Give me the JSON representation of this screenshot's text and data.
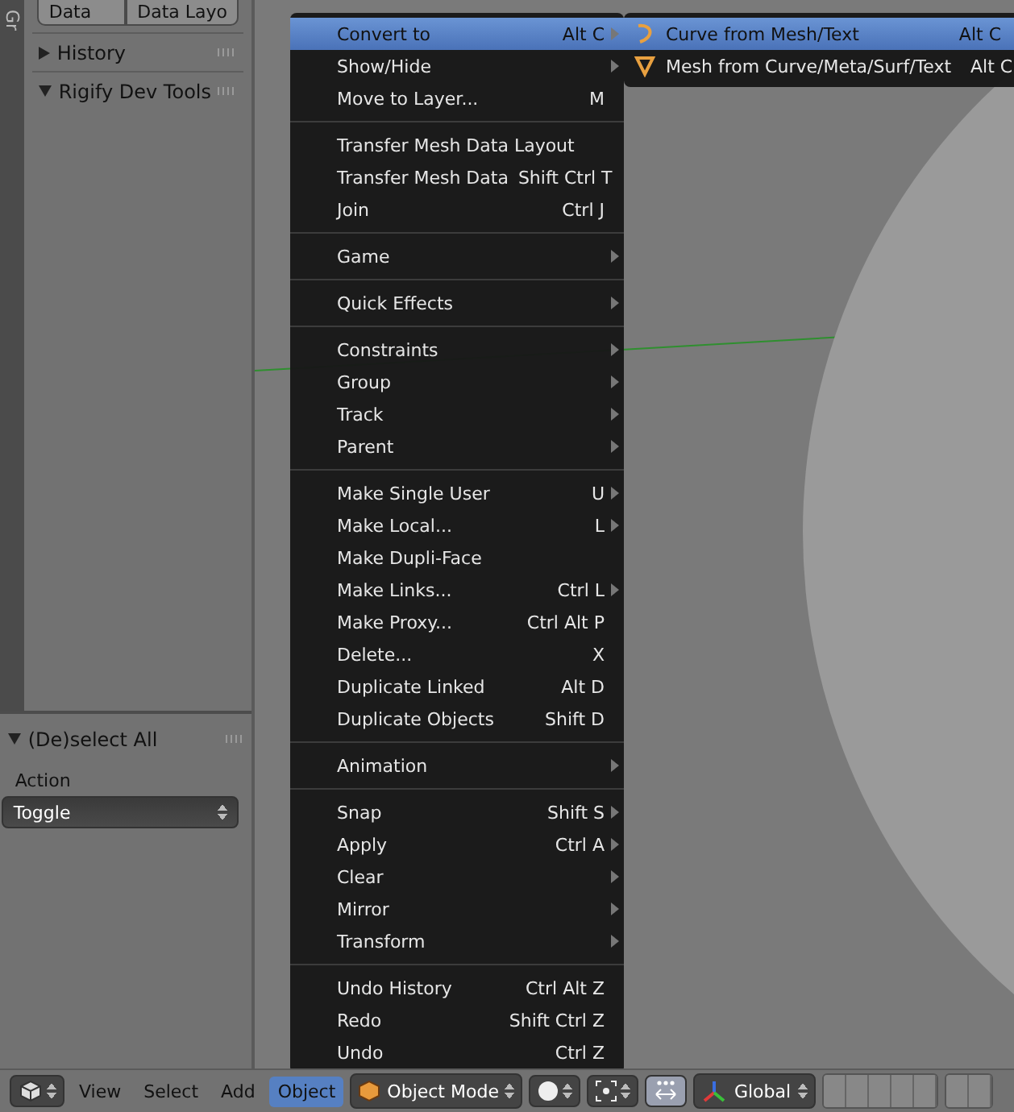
{
  "sidebar": {
    "vertical_tab": "Gr",
    "tabs": [
      {
        "label": "Data",
        "selected": false
      },
      {
        "label": "Data Layo",
        "selected": false
      }
    ],
    "panels": [
      {
        "title": "History",
        "expanded": false
      },
      {
        "title": "Rigify Dev Tools",
        "expanded": true
      }
    ],
    "operator_panel": {
      "title": "(De)select All",
      "expanded": true,
      "field_label": "Action",
      "field_value": "Toggle"
    }
  },
  "menu": {
    "sections": [
      [
        {
          "label": "Convert to",
          "shortcut": "Alt C",
          "submenu": true,
          "selected": true
        },
        {
          "label": "Show/Hide",
          "submenu": true,
          "selected": false
        },
        {
          "label": "Move to Layer...",
          "shortcut": "M",
          "submenu": false,
          "selected": false
        }
      ],
      [
        {
          "label": "Transfer Mesh Data Layout",
          "submenu": false,
          "selected": false
        },
        {
          "label": "Transfer Mesh Data",
          "shortcut": "Shift Ctrl T",
          "submenu": false,
          "selected": false
        },
        {
          "label": "Join",
          "shortcut": "Ctrl J",
          "submenu": false,
          "selected": false
        }
      ],
      [
        {
          "label": "Game",
          "submenu": true,
          "selected": false
        }
      ],
      [
        {
          "label": "Quick Effects",
          "submenu": true,
          "selected": false
        }
      ],
      [
        {
          "label": "Constraints",
          "submenu": true,
          "selected": false
        },
        {
          "label": "Group",
          "submenu": true,
          "selected": false
        },
        {
          "label": "Track",
          "submenu": true,
          "selected": false
        },
        {
          "label": "Parent",
          "submenu": true,
          "selected": false
        }
      ],
      [
        {
          "label": "Make Single User",
          "shortcut": "U",
          "submenu": true,
          "selected": false
        },
        {
          "label": "Make Local...",
          "shortcut": "L",
          "submenu": true,
          "selected": false
        },
        {
          "label": "Make Dupli-Face",
          "submenu": false,
          "selected": false
        },
        {
          "label": "Make Links...",
          "shortcut": "Ctrl L",
          "submenu": true,
          "selected": false
        },
        {
          "label": "Make Proxy...",
          "shortcut": "Ctrl Alt P",
          "submenu": false,
          "selected": false
        },
        {
          "label": "Delete...",
          "shortcut": "X",
          "submenu": false,
          "selected": false
        },
        {
          "label": "Duplicate Linked",
          "shortcut": "Alt D",
          "submenu": false,
          "selected": false
        },
        {
          "label": "Duplicate Objects",
          "shortcut": "Shift D",
          "submenu": false,
          "selected": false
        }
      ],
      [
        {
          "label": "Animation",
          "submenu": true,
          "selected": false
        }
      ],
      [
        {
          "label": "Snap",
          "shortcut": "Shift S",
          "submenu": true,
          "selected": false
        },
        {
          "label": "Apply",
          "shortcut": "Ctrl A",
          "submenu": true,
          "selected": false
        },
        {
          "label": "Clear",
          "submenu": true,
          "selected": false
        },
        {
          "label": "Mirror",
          "submenu": true,
          "selected": false
        },
        {
          "label": "Transform",
          "submenu": true,
          "selected": false
        }
      ],
      [
        {
          "label": "Undo History",
          "shortcut": "Ctrl Alt Z",
          "submenu": false,
          "selected": false
        },
        {
          "label": "Redo",
          "shortcut": "Shift Ctrl Z",
          "submenu": false,
          "selected": false
        },
        {
          "label": "Undo",
          "shortcut": "Ctrl Z",
          "submenu": false,
          "selected": false
        }
      ]
    ]
  },
  "submenu": {
    "items": [
      {
        "kind": "curve",
        "label": "Curve from Mesh/Text",
        "shortcut": "Alt C",
        "selected": true
      },
      {
        "kind": "mesh",
        "label": "Mesh from Curve/Meta/Surf/Text",
        "shortcut": "Alt C",
        "selected": false
      }
    ]
  },
  "header": {
    "menus": [
      {
        "label": "View",
        "selected": false
      },
      {
        "label": "Select",
        "selected": false
      },
      {
        "label": "Add",
        "selected": false
      },
      {
        "label": "Object",
        "selected": true
      }
    ],
    "mode": "Object Mode",
    "orientation": "Global"
  }
}
